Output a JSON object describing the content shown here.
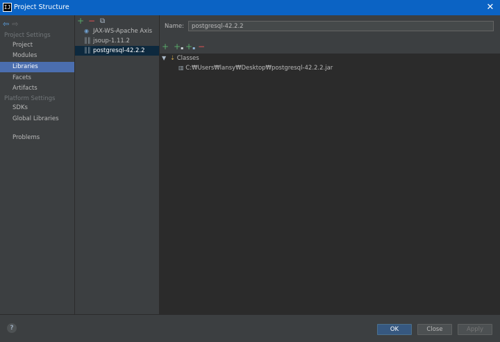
{
  "window": {
    "title": "Project Structure",
    "app_icon": "IJ"
  },
  "nav": {
    "back_icon": "⇦",
    "forward_icon": "⇨",
    "project_settings_header": "Project Settings",
    "platform_settings_header": "Platform Settings",
    "items": [
      {
        "label": "Project"
      },
      {
        "label": "Modules"
      },
      {
        "label": "Libraries"
      },
      {
        "label": "Facets"
      },
      {
        "label": "Artifacts"
      },
      {
        "label": "SDKs"
      },
      {
        "label": "Global Libraries"
      },
      {
        "label": "Problems"
      }
    ]
  },
  "libraries": {
    "items": [
      {
        "label": "JAX-WS-Apache Axis"
      },
      {
        "label": "jsoup-1.11.2"
      },
      {
        "label": "postgresql-42.2.2"
      }
    ]
  },
  "detail": {
    "name_label": "Name:",
    "name_value": "postgresql-42.2.2",
    "tree": {
      "classes_label": "Classes",
      "jar_path": "C:₩Users₩lansy₩Desktop₩postgresql-42.2.2.jar"
    }
  },
  "footer": {
    "help_label": "?",
    "ok_label": "OK",
    "close_label": "Close",
    "apply_label": "Apply"
  },
  "colors": {
    "titlebar": "#0b63c4",
    "selection": "#4b6eaf",
    "primary_button": "#365880"
  }
}
